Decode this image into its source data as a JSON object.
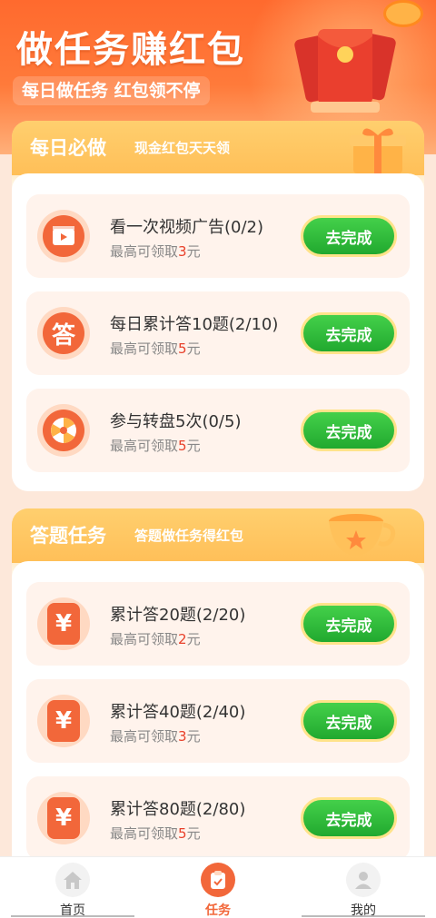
{
  "header": {
    "title": "做任务赚红包",
    "subtitle": "每日做任务 红包领不停"
  },
  "daily": {
    "title": "每日必做",
    "subtitle": "现金红包天天领",
    "tasks": [
      {
        "name": "看一次视频广告(0/2)",
        "reward_prefix": "最高可领取",
        "reward_amount": "3",
        "reward_unit": "元",
        "button": "去完成",
        "icon": "video-play-icon"
      },
      {
        "name": "每日累计答10题(2/10)",
        "reward_prefix": "最高可领取",
        "reward_amount": "5",
        "reward_unit": "元",
        "button": "去完成",
        "icon": "answer-icon",
        "icon_text": "答"
      },
      {
        "name": "参与转盘5次(0/5)",
        "reward_prefix": "最高可领取",
        "reward_amount": "5",
        "reward_unit": "元",
        "button": "去完成",
        "icon": "wheel-icon"
      }
    ]
  },
  "quiz": {
    "title": "答题任务",
    "subtitle": "答题做任务得红包",
    "tasks": [
      {
        "name": "累计答20题(2/20)",
        "reward_prefix": "最高可领取",
        "reward_amount": "2",
        "reward_unit": "元",
        "button": "去完成",
        "icon": "red-envelope-icon",
        "icon_text": "¥"
      },
      {
        "name": "累计答40题(2/40)",
        "reward_prefix": "最高可领取",
        "reward_amount": "3",
        "reward_unit": "元",
        "button": "去完成",
        "icon": "red-envelope-icon",
        "icon_text": "¥"
      },
      {
        "name": "累计答80题(2/80)",
        "reward_prefix": "最高可领取",
        "reward_amount": "5",
        "reward_unit": "元",
        "button": "去完成",
        "icon": "red-envelope-icon",
        "icon_text": "¥"
      }
    ]
  },
  "tabbar": {
    "items": [
      {
        "label": "首页",
        "icon": "home-icon",
        "active": false
      },
      {
        "label": "任务",
        "icon": "task-clipboard-icon",
        "active": true
      },
      {
        "label": "我的",
        "icon": "user-icon",
        "active": false
      }
    ]
  },
  "colors": {
    "header": "#ff6a2e",
    "section_head": "#ffbf58",
    "button_green": "#21a92f",
    "accent_red": "#e8402a",
    "active_tab": "#f2673a"
  }
}
